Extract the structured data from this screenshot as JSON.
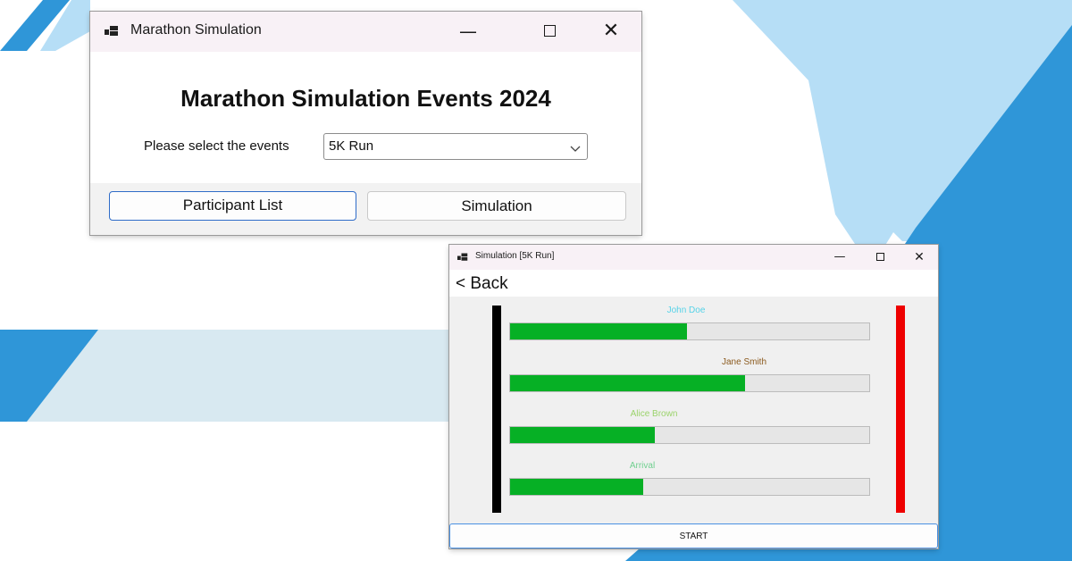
{
  "colors": {
    "background_dark_blue": "#2f96d8",
    "background_light_blue": "#b6def6",
    "background_pale_band": "#d8e9f1",
    "progress_fill": "#06b025",
    "start_line": "#000000",
    "finish_line": "#ee0000",
    "focus_border": "#2f6cc8"
  },
  "main_window": {
    "title": "Marathon Simulation",
    "icon": "app-window-icon",
    "minimize_glyph": "—",
    "close_glyph": "✕",
    "heading": "Marathon Simulation Events 2024",
    "event_label": "Please select the events",
    "event_select": {
      "value": "5K Run",
      "icon": "chevron-down-icon"
    },
    "buttons": {
      "participant_list": "Participant List",
      "simulation": "Simulation"
    }
  },
  "simulation_window": {
    "title": "Simulation [5K Run]",
    "icon": "app-window-icon",
    "minimize_glyph": "—",
    "close_glyph": "✕",
    "back_label": "< Back",
    "runners": [
      {
        "name": "John Doe",
        "name_color": "#56d3e8",
        "progress": 0.49
      },
      {
        "name": "Jane Smith",
        "name_color": "#8b5a1e",
        "progress": 0.65
      },
      {
        "name": "Alice Brown",
        "name_color": "#9bd36b",
        "progress": 0.4
      },
      {
        "name": "Arrival",
        "name_color": "#6fcf8f",
        "progress": 0.37
      }
    ],
    "start_button": "START"
  }
}
